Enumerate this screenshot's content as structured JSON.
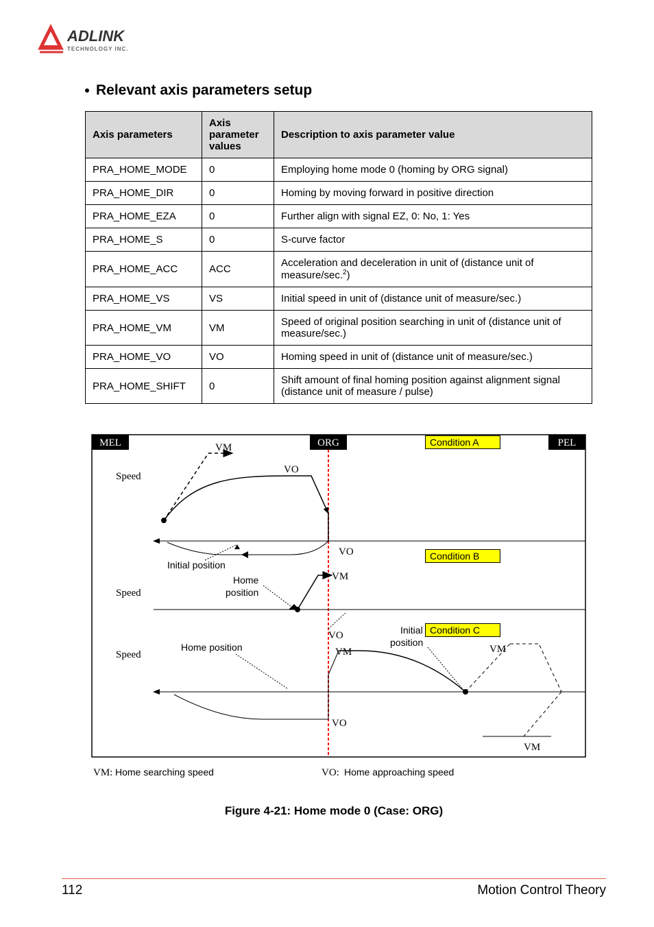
{
  "logo": {
    "brand": "ADLINK",
    "sub": "TECHNOLOGY INC."
  },
  "section_heading": "Relevant axis parameters setup",
  "table": {
    "headers": {
      "c0": "Axis parameters",
      "c1": "Axis parameter values",
      "c2": "Description to axis parameter value"
    },
    "rows": [
      {
        "p": "PRA_HOME_MODE",
        "v": "0",
        "d": "Employing home mode 0 (homing by ORG signal)"
      },
      {
        "p": "PRA_HOME_DIR",
        "v": "0",
        "d": "Homing by moving forward in positive direction"
      },
      {
        "p": "PRA_HOME_EZA",
        "v": "0",
        "d": "Further align with signal EZ, 0: No, 1: Yes"
      },
      {
        "p": "PRA_HOME_S",
        "v": "0",
        "d": "S-curve factor"
      },
      {
        "p": "PRA_HOME_ACC",
        "v": "ACC",
        "d": "Acceleration and deceleration in unit of (distance unit of measure/sec.",
        "sup": "2",
        "d2": ")"
      },
      {
        "p": "PRA_HOME_VS",
        "v": "VS",
        "d": "Initial speed in unit of (distance unit of measure/sec.)"
      },
      {
        "p": "PRA_HOME_VM",
        "v": "VM",
        "d": "Speed of original position searching in unit of (distance unit of measure/sec.)"
      },
      {
        "p": "PRA_HOME_VO",
        "v": "VO",
        "d": "Homing speed in unit of (distance unit of measure/sec.)"
      },
      {
        "p": "PRA_HOME_SHIFT",
        "v": "0",
        "d": "Shift amount of final homing position against alignment signal (distance unit of measure / pulse)"
      }
    ]
  },
  "diagram": {
    "mel": "MEL",
    "org": "ORG",
    "pel": "PEL",
    "speed": "Speed",
    "vm": "VM",
    "vo": "VO",
    "cond_a": "Condition A",
    "cond_b": "Condition B",
    "cond_c": "Condition C",
    "initial_position": "Initial position",
    "initial": "Initial",
    "position": "position",
    "home": "Home",
    "home_position": "Home position",
    "legend_vm_prefix": "VM:",
    "legend_vm": " Home searching speed",
    "legend_vo_prefix": "VO:",
    "legend_vo": " Home approaching speed"
  },
  "caption": "Figure 4-21: Home mode 0 (Case:  ORG)",
  "footer": {
    "page": "112",
    "title": "Motion Control Theory"
  }
}
